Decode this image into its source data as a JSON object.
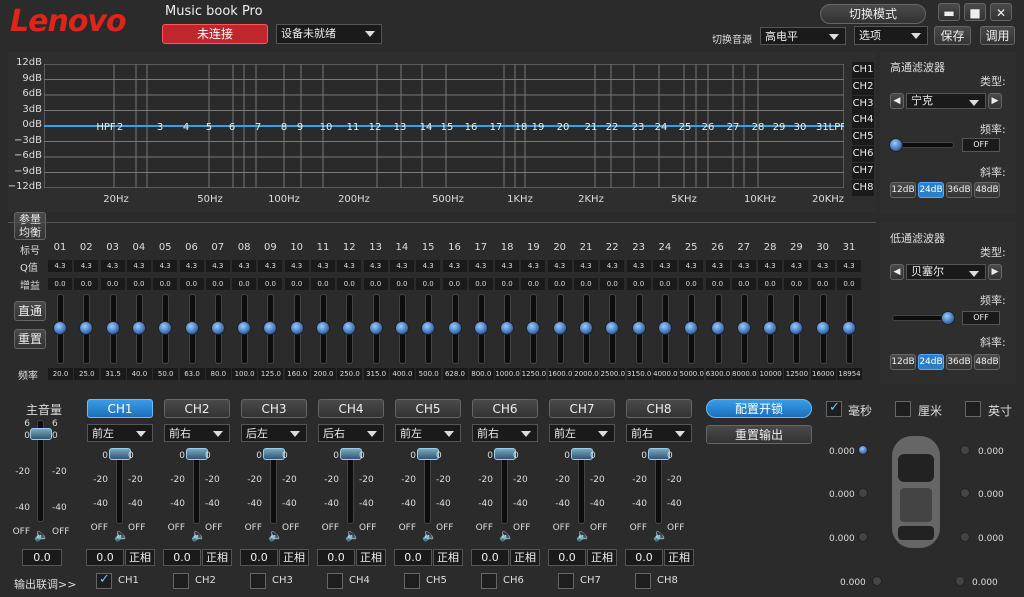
{
  "app": {
    "logo": "Lenovo",
    "title": "Music book Pro",
    "status": "未连接",
    "device": "设备未就绪",
    "switch_mode": "切换模式",
    "source_label": "切换音源",
    "source_value": "高电平",
    "options": "选项",
    "save": "保存",
    "load": "调用"
  },
  "eq": {
    "db_labels": [
      "12dB",
      "9dB",
      "6dB",
      "3dB",
      "0dB",
      "−3dB",
      "−6dB",
      "−9dB",
      "−12dB"
    ],
    "freq_labels": [
      "20Hz",
      "50Hz",
      "100Hz",
      "200Hz",
      "500Hz",
      "1KHz",
      "2KHz",
      "5KHz",
      "10KHz",
      "20KHz"
    ],
    "point_labels": [
      "HPF",
      "2",
      "3",
      "4",
      "5",
      "6",
      "7",
      "8",
      "9",
      "10",
      "11",
      "12",
      "13",
      "14",
      "15",
      "16",
      "17",
      "18",
      "19",
      "20",
      "21",
      "22",
      "23",
      "24",
      "25",
      "26",
      "27",
      "28",
      "29",
      "30",
      "31LPF"
    ],
    "channels": [
      "CH1",
      "CH2",
      "CH3",
      "CH4",
      "CH5",
      "CH6",
      "CH7",
      "CH8"
    ]
  },
  "hp": {
    "title": "高通滤波器",
    "type_label": "类型:",
    "type": "宁克",
    "freq_label": "频率:",
    "freq": "OFF",
    "slope_label": "斜率:",
    "slopes": [
      "12dB",
      "24dB",
      "36dB",
      "48dB"
    ]
  },
  "lp": {
    "title": "低通滤波器",
    "type_label": "类型:",
    "type": "贝塞尔",
    "freq_label": "频率:",
    "freq": "OFF",
    "slope_label": "斜率:",
    "slopes": [
      "12dB",
      "24dB",
      "36dB",
      "48dB"
    ]
  },
  "bands": {
    "param_btn": "参量\n均衡",
    "bypass": "直通",
    "reset": "重置",
    "hdr_index": "标号",
    "hdr_q": "Q值",
    "hdr_gain": "增益",
    "hdr_freq": "频率",
    "index": [
      "01",
      "02",
      "03",
      "04",
      "05",
      "06",
      "07",
      "08",
      "09",
      "10",
      "11",
      "12",
      "13",
      "14",
      "15",
      "16",
      "17",
      "18",
      "19",
      "20",
      "21",
      "22",
      "23",
      "24",
      "25",
      "26",
      "27",
      "28",
      "29",
      "30",
      "31"
    ],
    "q": "4.3",
    "gain": "0.0",
    "freqs": [
      "20.0",
      "25.0",
      "31.5",
      "40.0",
      "50.0",
      "63.0",
      "80.0",
      "100.0",
      "125.0",
      "160.0",
      "200.0",
      "250.0",
      "315.0",
      "400.0",
      "500.0",
      "628.0",
      "800.0",
      "1000.0",
      "1250.0",
      "1600.0",
      "2000.0",
      "2500.0",
      "3150.0",
      "4000.0",
      "5000.0",
      "6300.0",
      "8000.0",
      "10000",
      "12500",
      "16000",
      "18954"
    ]
  },
  "master": {
    "label": "主音量",
    "value": "0.0",
    "scale": [
      "6",
      "0",
      "-20",
      "-40",
      "OFF"
    ]
  },
  "outputs": {
    "names": [
      "CH1",
      "CH2",
      "CH3",
      "CH4",
      "CH5",
      "CH6",
      "CH7",
      "CH8"
    ],
    "positions": [
      "前左",
      "前右",
      "后左",
      "后右",
      "前左",
      "前右",
      "前左",
      "前右"
    ],
    "value": "0.0",
    "phase": "正相",
    "scale": [
      "0",
      "-20",
      "-40",
      "OFF"
    ]
  },
  "config": {
    "lock": "配置开锁",
    "reset_out": "重置输出"
  },
  "units": {
    "ms": "毫秒",
    "cm": "厘米",
    "inch": "英寸"
  },
  "delays": {
    "left": [
      "0.000",
      "0.000",
      "0.000"
    ],
    "right": [
      "0.000",
      "0.000",
      "0.000"
    ],
    "bottom_left": "0.000",
    "bottom_right": "0.000"
  },
  "link": {
    "label": "输出联调>>",
    "checks": [
      "CH1",
      "CH2",
      "CH3",
      "CH4",
      "CH5",
      "CH6",
      "CH7",
      "CH8"
    ]
  }
}
